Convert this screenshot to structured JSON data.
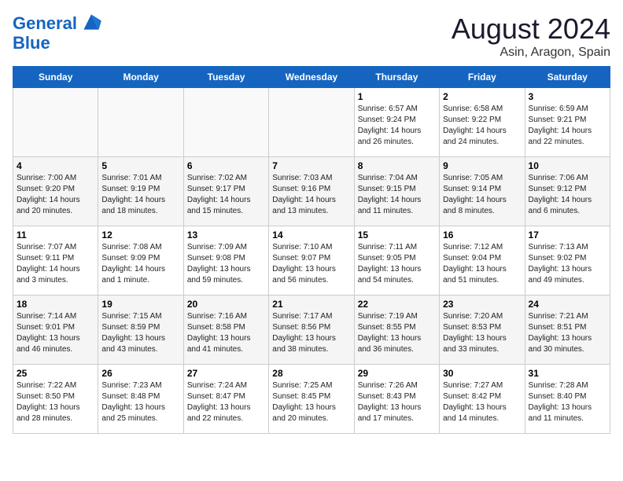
{
  "logo": {
    "line1": "General",
    "line2": "Blue"
  },
  "title": "August 2024",
  "subtitle": "Asin, Aragon, Spain",
  "weekdays": [
    "Sunday",
    "Monday",
    "Tuesday",
    "Wednesday",
    "Thursday",
    "Friday",
    "Saturday"
  ],
  "weeks": [
    [
      {
        "day": "",
        "info": ""
      },
      {
        "day": "",
        "info": ""
      },
      {
        "day": "",
        "info": ""
      },
      {
        "day": "",
        "info": ""
      },
      {
        "day": "1",
        "info": "Sunrise: 6:57 AM\nSunset: 9:24 PM\nDaylight: 14 hours\nand 26 minutes."
      },
      {
        "day": "2",
        "info": "Sunrise: 6:58 AM\nSunset: 9:22 PM\nDaylight: 14 hours\nand 24 minutes."
      },
      {
        "day": "3",
        "info": "Sunrise: 6:59 AM\nSunset: 9:21 PM\nDaylight: 14 hours\nand 22 minutes."
      }
    ],
    [
      {
        "day": "4",
        "info": "Sunrise: 7:00 AM\nSunset: 9:20 PM\nDaylight: 14 hours\nand 20 minutes."
      },
      {
        "day": "5",
        "info": "Sunrise: 7:01 AM\nSunset: 9:19 PM\nDaylight: 14 hours\nand 18 minutes."
      },
      {
        "day": "6",
        "info": "Sunrise: 7:02 AM\nSunset: 9:17 PM\nDaylight: 14 hours\nand 15 minutes."
      },
      {
        "day": "7",
        "info": "Sunrise: 7:03 AM\nSunset: 9:16 PM\nDaylight: 14 hours\nand 13 minutes."
      },
      {
        "day": "8",
        "info": "Sunrise: 7:04 AM\nSunset: 9:15 PM\nDaylight: 14 hours\nand 11 minutes."
      },
      {
        "day": "9",
        "info": "Sunrise: 7:05 AM\nSunset: 9:14 PM\nDaylight: 14 hours\nand 8 minutes."
      },
      {
        "day": "10",
        "info": "Sunrise: 7:06 AM\nSunset: 9:12 PM\nDaylight: 14 hours\nand 6 minutes."
      }
    ],
    [
      {
        "day": "11",
        "info": "Sunrise: 7:07 AM\nSunset: 9:11 PM\nDaylight: 14 hours\nand 3 minutes."
      },
      {
        "day": "12",
        "info": "Sunrise: 7:08 AM\nSunset: 9:09 PM\nDaylight: 14 hours\nand 1 minute."
      },
      {
        "day": "13",
        "info": "Sunrise: 7:09 AM\nSunset: 9:08 PM\nDaylight: 13 hours\nand 59 minutes."
      },
      {
        "day": "14",
        "info": "Sunrise: 7:10 AM\nSunset: 9:07 PM\nDaylight: 13 hours\nand 56 minutes."
      },
      {
        "day": "15",
        "info": "Sunrise: 7:11 AM\nSunset: 9:05 PM\nDaylight: 13 hours\nand 54 minutes."
      },
      {
        "day": "16",
        "info": "Sunrise: 7:12 AM\nSunset: 9:04 PM\nDaylight: 13 hours\nand 51 minutes."
      },
      {
        "day": "17",
        "info": "Sunrise: 7:13 AM\nSunset: 9:02 PM\nDaylight: 13 hours\nand 49 minutes."
      }
    ],
    [
      {
        "day": "18",
        "info": "Sunrise: 7:14 AM\nSunset: 9:01 PM\nDaylight: 13 hours\nand 46 minutes."
      },
      {
        "day": "19",
        "info": "Sunrise: 7:15 AM\nSunset: 8:59 PM\nDaylight: 13 hours\nand 43 minutes."
      },
      {
        "day": "20",
        "info": "Sunrise: 7:16 AM\nSunset: 8:58 PM\nDaylight: 13 hours\nand 41 minutes."
      },
      {
        "day": "21",
        "info": "Sunrise: 7:17 AM\nSunset: 8:56 PM\nDaylight: 13 hours\nand 38 minutes."
      },
      {
        "day": "22",
        "info": "Sunrise: 7:19 AM\nSunset: 8:55 PM\nDaylight: 13 hours\nand 36 minutes."
      },
      {
        "day": "23",
        "info": "Sunrise: 7:20 AM\nSunset: 8:53 PM\nDaylight: 13 hours\nand 33 minutes."
      },
      {
        "day": "24",
        "info": "Sunrise: 7:21 AM\nSunset: 8:51 PM\nDaylight: 13 hours\nand 30 minutes."
      }
    ],
    [
      {
        "day": "25",
        "info": "Sunrise: 7:22 AM\nSunset: 8:50 PM\nDaylight: 13 hours\nand 28 minutes."
      },
      {
        "day": "26",
        "info": "Sunrise: 7:23 AM\nSunset: 8:48 PM\nDaylight: 13 hours\nand 25 minutes."
      },
      {
        "day": "27",
        "info": "Sunrise: 7:24 AM\nSunset: 8:47 PM\nDaylight: 13 hours\nand 22 minutes."
      },
      {
        "day": "28",
        "info": "Sunrise: 7:25 AM\nSunset: 8:45 PM\nDaylight: 13 hours\nand 20 minutes."
      },
      {
        "day": "29",
        "info": "Sunrise: 7:26 AM\nSunset: 8:43 PM\nDaylight: 13 hours\nand 17 minutes."
      },
      {
        "day": "30",
        "info": "Sunrise: 7:27 AM\nSunset: 8:42 PM\nDaylight: 13 hours\nand 14 minutes."
      },
      {
        "day": "31",
        "info": "Sunrise: 7:28 AM\nSunset: 8:40 PM\nDaylight: 13 hours\nand 11 minutes."
      }
    ]
  ]
}
